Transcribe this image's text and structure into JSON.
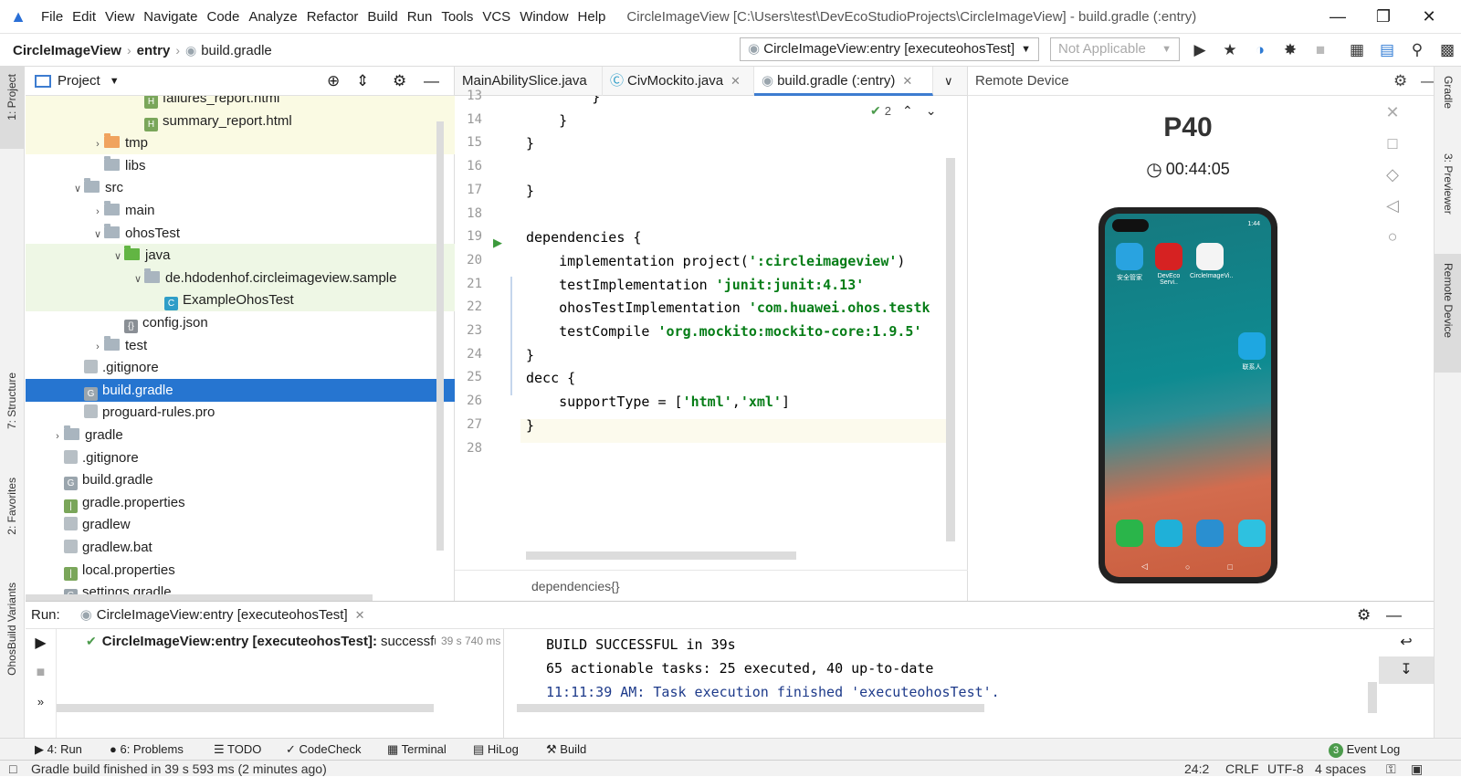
{
  "menubar": {
    "items": [
      "File",
      "Edit",
      "View",
      "Navigate",
      "Code",
      "Analyze",
      "Refactor",
      "Build",
      "Run",
      "Tools",
      "VCS",
      "Window",
      "Help"
    ],
    "title": "CircleImageView [C:\\Users\\test\\DevEcoStudioProjects\\CircleImageView] - build.gradle (:entry)"
  },
  "navbar": {
    "crumbs": [
      "CircleImageView",
      "entry",
      "build.gradle"
    ],
    "run_config": "CircleImageView:entry [executeohosTest]",
    "device": "Not Applicable"
  },
  "left_stripe": {
    "project": "1: Project",
    "structure": "7: Structure",
    "favorites": "2: Favorites",
    "variants": "OhosBuild Variants"
  },
  "right_stripe": {
    "gradle": "Gradle",
    "previewer": "3: Previewer",
    "remote": "Remote Device"
  },
  "project": {
    "title": "Project",
    "nodes": [
      {
        "label": "failures_report.html",
        "depth": 6,
        "type": "html",
        "hl": "yellow"
      },
      {
        "label": "summary_report.html",
        "depth": 6,
        "type": "html",
        "hl": "yellow"
      },
      {
        "label": "tmp",
        "depth": 4,
        "type": "folder-orange",
        "arrow": "right",
        "hl": "yellow"
      },
      {
        "label": "libs",
        "depth": 4,
        "type": "folder"
      },
      {
        "label": "src",
        "depth": 3,
        "type": "folder",
        "arrow": "down"
      },
      {
        "label": "main",
        "depth": 4,
        "type": "folder",
        "arrow": "right"
      },
      {
        "label": "ohosTest",
        "depth": 4,
        "type": "folder",
        "arrow": "down"
      },
      {
        "label": "java",
        "depth": 5,
        "type": "folder-green",
        "arrow": "down",
        "hl": "green"
      },
      {
        "label": "de.hdodenhof.circleimageview.sample",
        "depth": 6,
        "type": "folder",
        "arrow": "down",
        "hl": "green"
      },
      {
        "label": "ExampleOhosTest",
        "depth": 7,
        "type": "class",
        "hl": "green"
      },
      {
        "label": "config.json",
        "depth": 5,
        "type": "json"
      },
      {
        "label": "test",
        "depth": 4,
        "type": "folder",
        "arrow": "right"
      },
      {
        "label": ".gitignore",
        "depth": 3,
        "type": "file"
      },
      {
        "label": "build.gradle",
        "depth": 3,
        "type": "gradle",
        "selected": true
      },
      {
        "label": "proguard-rules.pro",
        "depth": 3,
        "type": "file"
      },
      {
        "label": "gradle",
        "depth": 2,
        "type": "folder",
        "arrow": "right"
      },
      {
        "label": ".gitignore",
        "depth": 2,
        "type": "file"
      },
      {
        "label": "build.gradle",
        "depth": 2,
        "type": "gradle"
      },
      {
        "label": "gradle.properties",
        "depth": 2,
        "type": "props"
      },
      {
        "label": "gradlew",
        "depth": 2,
        "type": "file"
      },
      {
        "label": "gradlew.bat",
        "depth": 2,
        "type": "file"
      },
      {
        "label": "local.properties",
        "depth": 2,
        "type": "props"
      },
      {
        "label": "settings.gradle",
        "depth": 2,
        "type": "gradle"
      }
    ]
  },
  "editor": {
    "tabs": [
      "MainAbilitySlice.java",
      "CivMockito.java",
      "build.gradle (:entry)"
    ],
    "inspection_count": "2",
    "lines": [
      {
        "n": "13",
        "t": "        }"
      },
      {
        "n": "14",
        "t": "    }"
      },
      {
        "n": "15",
        "t": "}"
      },
      {
        "n": "16",
        "t": ""
      },
      {
        "n": "17",
        "t": "}"
      },
      {
        "n": "18",
        "t": ""
      },
      {
        "n": "19",
        "t": "dependencies {"
      },
      {
        "n": "20",
        "t": "    implementation project(':circleimageview')"
      },
      {
        "n": "21",
        "t": "    testImplementation 'junit:junit:4.13'"
      },
      {
        "n": "22",
        "t": "    ohosTestImplementation 'com.huawei.ohos.testk"
      },
      {
        "n": "23",
        "t": "    testCompile 'org.mockito:mockito-core:1.9.5'"
      },
      {
        "n": "24",
        "t": "}"
      },
      {
        "n": "25",
        "t": "decc {"
      },
      {
        "n": "26",
        "t": "    supportType = ['html','xml']"
      },
      {
        "n": "27",
        "t": "}"
      },
      {
        "n": "28",
        "t": ""
      }
    ],
    "breadcrumb": "dependencies{}"
  },
  "remote": {
    "title": "Remote Device",
    "device_name": "P40",
    "timer": "00:44:05",
    "apps": [
      "安全管家",
      "DevEco Servi..",
      "CircleImageVi.."
    ],
    "contact_label": "联系人",
    "status_time": "1:44"
  },
  "run": {
    "label": "Run:",
    "tab": "CircleImageView:entry [executeohosTest]",
    "test_name": "CircleImageView:entry [executeohosTest]:",
    "test_status": "successfu",
    "test_time": "39 s 740 ms",
    "console": [
      "BUILD SUCCESSFUL in 39s",
      "65 actionable tasks: 25 executed, 40 up-to-date",
      "11:11:39 AM: Task execution finished 'executeohosTest'."
    ]
  },
  "toolwindows": {
    "run": "4: Run",
    "problems": "6: Problems",
    "todo": "TODO",
    "codecheck": "CodeCheck",
    "terminal": "Terminal",
    "hilog": "HiLog",
    "build": "Build",
    "eventlog_count": "3",
    "eventlog": "Event Log"
  },
  "status": {
    "message": "Gradle build finished in 39 s 593 ms (2 minutes ago)",
    "position": "24:2",
    "line_sep": "CRLF",
    "encoding": "UTF-8",
    "indent": "4 spaces"
  },
  "colors": {
    "selection": "#2675d0",
    "success": "#62b543",
    "string": "#067d17"
  }
}
